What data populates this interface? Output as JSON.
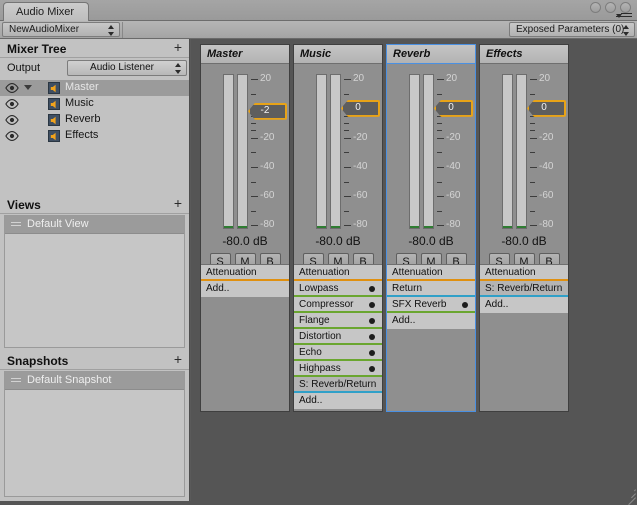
{
  "window": {
    "tab_label": "Audio Mixer",
    "controls": [
      "minimize",
      "maximize",
      "close"
    ],
    "menu_icon": "hamburger-menu-icon"
  },
  "toolbar": {
    "mixer_name": "NewAudioMixer",
    "exposed_parameters": "Exposed Parameters (0)"
  },
  "sidebar": {
    "mixer_tree": {
      "title": "Mixer Tree",
      "add_label": "+",
      "output_label": "Output",
      "output_value": "Audio Listener",
      "groups": [
        {
          "name": "Master",
          "indent": 0,
          "selected": true,
          "has_foldout": true,
          "icon": "speaker-icon",
          "eye": "visibility-eye-icon"
        },
        {
          "name": "Music",
          "indent": 1,
          "selected": false,
          "has_foldout": false,
          "icon": "speaker-icon",
          "eye": "visibility-eye-icon"
        },
        {
          "name": "Reverb",
          "indent": 1,
          "selected": false,
          "has_foldout": false,
          "icon": "speaker-icon",
          "eye": "visibility-eye-icon"
        },
        {
          "name": "Effects",
          "indent": 1,
          "selected": false,
          "has_foldout": false,
          "icon": "speaker-icon",
          "eye": "visibility-eye-icon"
        }
      ]
    },
    "views": {
      "title": "Views",
      "add_label": "+",
      "items": [
        {
          "name": "Default View",
          "selected": true
        }
      ]
    },
    "snapshots": {
      "title": "Snapshots",
      "add_label": "+",
      "items": [
        {
          "name": "Default Snapshot",
          "selected": true
        }
      ]
    }
  },
  "mixer": {
    "scale_ticks": [
      {
        "label": "20",
        "value": 20,
        "major": true
      },
      {
        "label": "",
        "value": 10,
        "major": false
      },
      {
        "label": "0",
        "value": 0,
        "major": true
      },
      {
        "label": "",
        "value": -5,
        "major": false
      },
      {
        "label": "",
        "value": -10,
        "major": false
      },
      {
        "label": "",
        "value": -15,
        "major": false
      },
      {
        "label": "-20",
        "value": -20,
        "major": true
      },
      {
        "label": "",
        "value": -30,
        "major": false
      },
      {
        "label": "-40",
        "value": -40,
        "major": true
      },
      {
        "label": "",
        "value": -50,
        "major": false
      },
      {
        "label": "-60",
        "value": -60,
        "major": true
      },
      {
        "label": "",
        "value": -70,
        "major": false
      },
      {
        "label": "-80",
        "value": -80,
        "major": true
      }
    ],
    "solo_label": "S",
    "mute_label": "M",
    "bypass_label": "B",
    "add_label": "Add..",
    "strips": [
      {
        "name": "Master",
        "selected": false,
        "fader_value": "-2",
        "fader_db": -2,
        "db_readout": "-80.0 dB",
        "effects": [
          {
            "label": "Attenuation",
            "kind": "attenuation",
            "has_dot": false
          },
          {
            "label": "Add..",
            "kind": "add",
            "has_dot": false
          }
        ]
      },
      {
        "name": "Music",
        "selected": false,
        "fader_value": "0",
        "fader_db": 0,
        "db_readout": "-80.0 dB",
        "effects": [
          {
            "label": "Attenuation",
            "kind": "attenuation",
            "has_dot": false
          },
          {
            "label": "Lowpass",
            "kind": "effect",
            "has_dot": true
          },
          {
            "label": "Compressor",
            "kind": "effect",
            "has_dot": true
          },
          {
            "label": "Flange",
            "kind": "effect",
            "has_dot": true
          },
          {
            "label": "Distortion",
            "kind": "effect",
            "has_dot": true
          },
          {
            "label": "Echo",
            "kind": "effect",
            "has_dot": true
          },
          {
            "label": "Highpass",
            "kind": "effect",
            "has_dot": true
          },
          {
            "label": "S: Reverb/Return",
            "kind": "send",
            "has_dot": false,
            "darker": true
          },
          {
            "label": "Add..",
            "kind": "add",
            "has_dot": false
          }
        ]
      },
      {
        "name": "Reverb",
        "selected": true,
        "fader_value": "0",
        "fader_db": 0,
        "db_readout": "-80.0 dB",
        "effects": [
          {
            "label": "Attenuation",
            "kind": "attenuation",
            "has_dot": false
          },
          {
            "label": "Return",
            "kind": "plain",
            "has_dot": false
          },
          {
            "label": "SFX Reverb",
            "kind": "effect",
            "has_dot": true
          },
          {
            "label": "Add..",
            "kind": "add",
            "has_dot": false
          }
        ]
      },
      {
        "name": "Effects",
        "selected": false,
        "fader_value": "0",
        "fader_db": 0,
        "db_readout": "-80.0 dB",
        "effects": [
          {
            "label": "Attenuation",
            "kind": "attenuation",
            "has_dot": false
          },
          {
            "label": "S: Reverb/Return",
            "kind": "send",
            "has_dot": false,
            "darker": true
          },
          {
            "label": "Add..",
            "kind": "add",
            "has_dot": false
          }
        ]
      }
    ]
  }
}
